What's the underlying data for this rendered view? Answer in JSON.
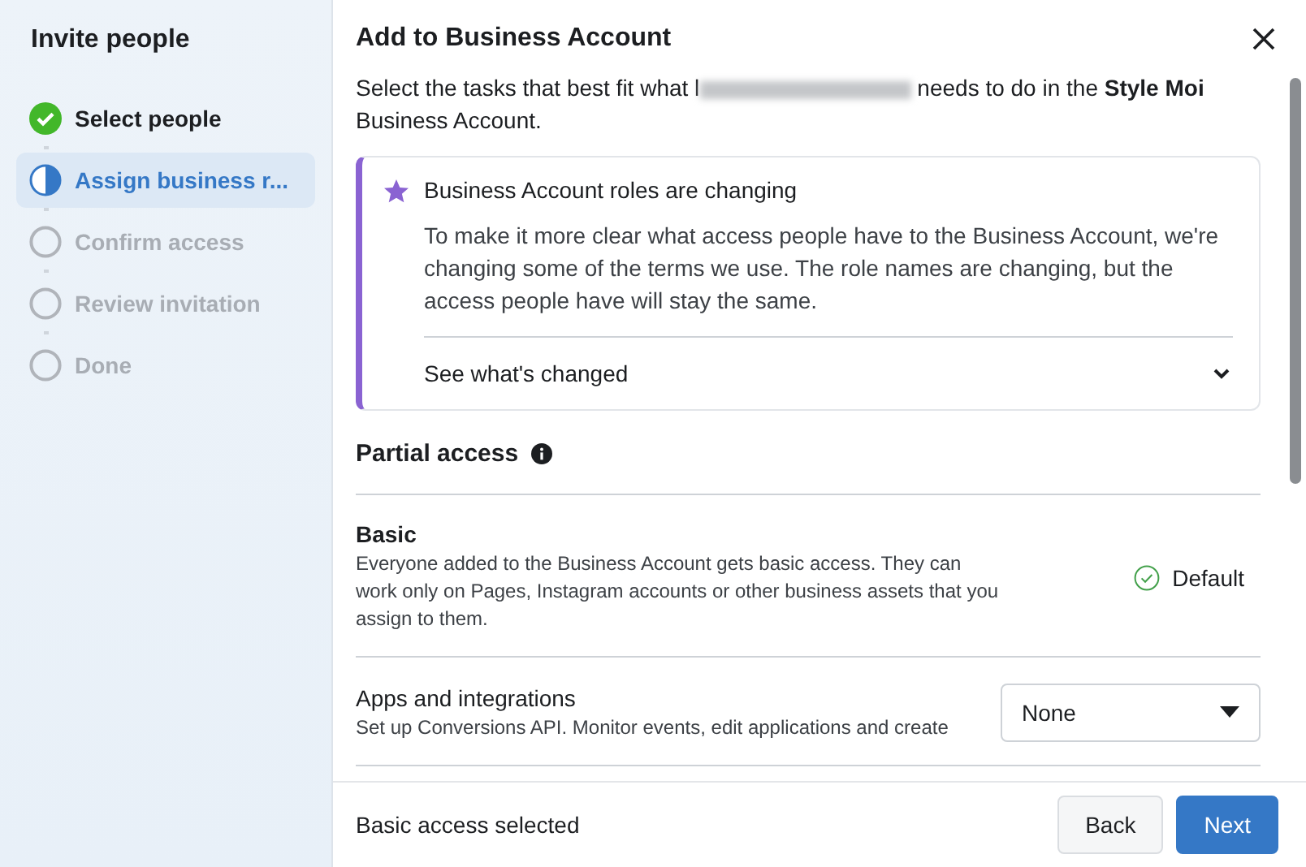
{
  "sidebar": {
    "title": "Invite people",
    "steps": [
      {
        "label": "Select people",
        "kind": "done",
        "selected": false
      },
      {
        "label": "Assign business r...",
        "kind": "current",
        "selected": true
      },
      {
        "label": "Confirm access",
        "kind": "pending",
        "selected": false
      },
      {
        "label": "Review invitation",
        "kind": "pending",
        "selected": false
      },
      {
        "label": "Done",
        "kind": "pending",
        "selected": false
      }
    ]
  },
  "dialog": {
    "title": "Add to Business Account",
    "intro_before": "Select the tasks that best fit what l",
    "intro_after": "needs to do in the **Style Moi** Business Account.",
    "notice": {
      "title": "Business Account roles are changing",
      "body": "To make it more clear what access people have to the Business Account, we're changing some of the terms we use. The role names are changing, but the access people have will stay the same.",
      "expander": "See what's changed",
      "expanded": false
    },
    "section_title": "Partial access",
    "access_rows": [
      {
        "kind": "default",
        "name": "Basic",
        "description": "Everyone added to the Business Account gets basic access. They can work only on Pages, Instagram accounts or other business assets that you assign to them.",
        "value": "Default"
      },
      {
        "kind": "dropdown",
        "name": "Apps and integrations",
        "description": "Set up Conversions API. Monitor events, edit applications and create",
        "value": "None"
      }
    ],
    "footer": {
      "status": "Basic access selected",
      "buttons": [
        {
          "label": "Back",
          "kind": "secondary"
        },
        {
          "label": "Next",
          "kind": "primary"
        }
      ]
    }
  }
}
